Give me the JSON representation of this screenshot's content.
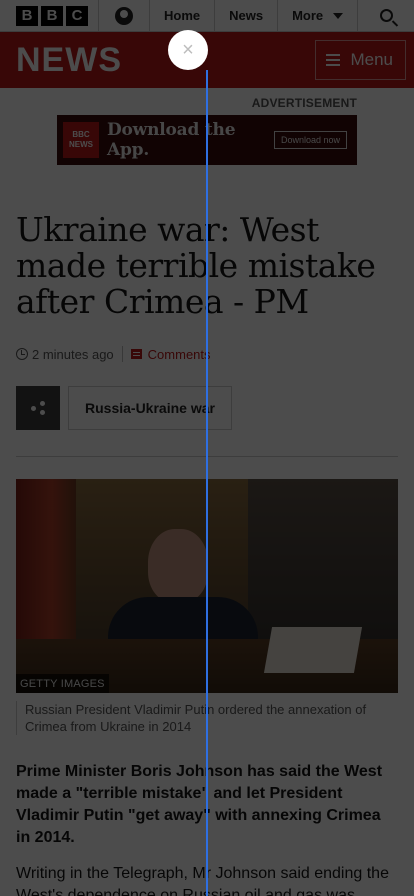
{
  "topbar": {
    "logo_letters": [
      "B",
      "B",
      "C"
    ],
    "nav": {
      "home": "Home",
      "news": "News",
      "more": "More"
    }
  },
  "newsbar": {
    "brand": "NEWS",
    "menu_label": "Menu",
    "brand_color": "#bb1919"
  },
  "advert": {
    "label": "ADVERTISEMENT",
    "logo_text": [
      "BBC",
      "NEWS"
    ],
    "headline": "Download the App.",
    "cta": "Download now"
  },
  "article": {
    "headline": "Ukraine war: West made terrible mistake after Crimea - PM",
    "timestamp": "2 minutes ago",
    "comments": "Comments",
    "topic": "Russia-Ukraine war",
    "image_credit": "GETTY IMAGES",
    "caption": "Russian President Vladimir Putin ordered the annexation of Crimea from Ukraine in 2014",
    "lede": "Prime Minister Boris Johnson has said the West made a \"terrible mistake\" and let President Vladimir Putin \"get away\" with annexing Crimea in 2014.",
    "paragraph": "Writing in the Telegraph, Mr Johnson said ending the West's dependence on Russian oil and gas was"
  },
  "overlay": {
    "close_glyph": "×",
    "guide_color": "#2f6fe0"
  }
}
